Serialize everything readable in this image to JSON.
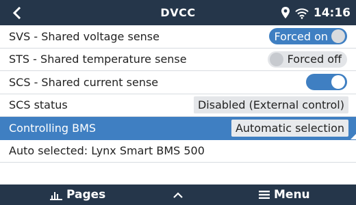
{
  "header": {
    "title": "DVCC",
    "time": "14:16"
  },
  "rows": [
    {
      "label": "SVS - Shared voltage sense",
      "value": "Forced on"
    },
    {
      "label": "STS - Shared temperature sense",
      "value": "Forced off"
    },
    {
      "label": "SCS - Shared current sense",
      "toggle_on": true
    },
    {
      "label": "SCS status",
      "value": "Disabled (External control)"
    },
    {
      "label": "Controlling BMS",
      "value": "Automatic selection"
    },
    {
      "label": "Auto selected: Lynx Smart BMS 500"
    }
  ],
  "footer": {
    "pages_label": "Pages",
    "menu_label": "Menu"
  },
  "colors": {
    "header_bg": "#25364a",
    "accent": "#3f7fc2"
  }
}
